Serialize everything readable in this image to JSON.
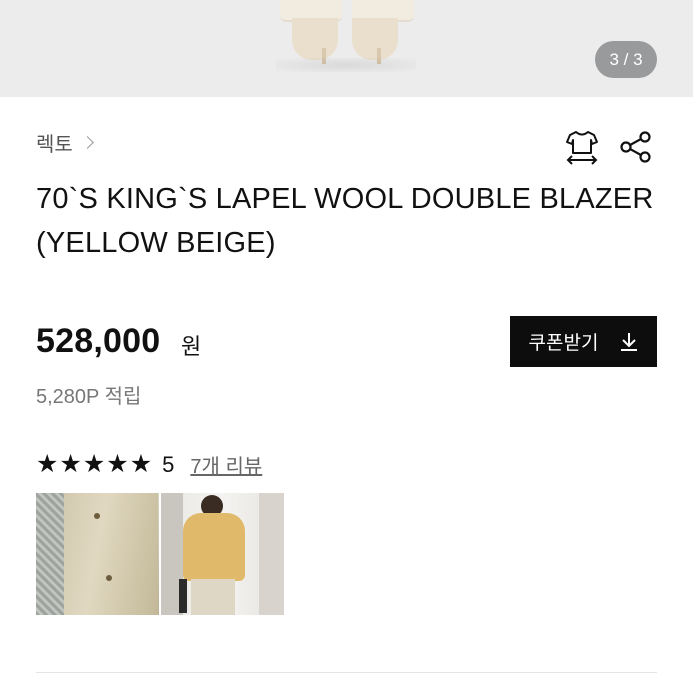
{
  "gallery": {
    "counter": "3 / 3"
  },
  "breadcrumb": {
    "brand": "렉토"
  },
  "icons": {
    "size_guide": "shirt-size-icon",
    "share": "share-icon",
    "coupon_download": "download-icon"
  },
  "product": {
    "title": "70`S KING`S LAPEL WOOL DOUBLE BLAZER (YELLOW BEIGE)",
    "price": "528,000",
    "price_unit": "원",
    "points": "5,280P 적립"
  },
  "coupon": {
    "label": "쿠폰받기"
  },
  "rating": {
    "stars": 5,
    "score": "5",
    "review_link": "7개 리뷰"
  },
  "colors": {
    "coupon_bg": "#0d0d0d",
    "counter_bg": "#999a9b"
  }
}
